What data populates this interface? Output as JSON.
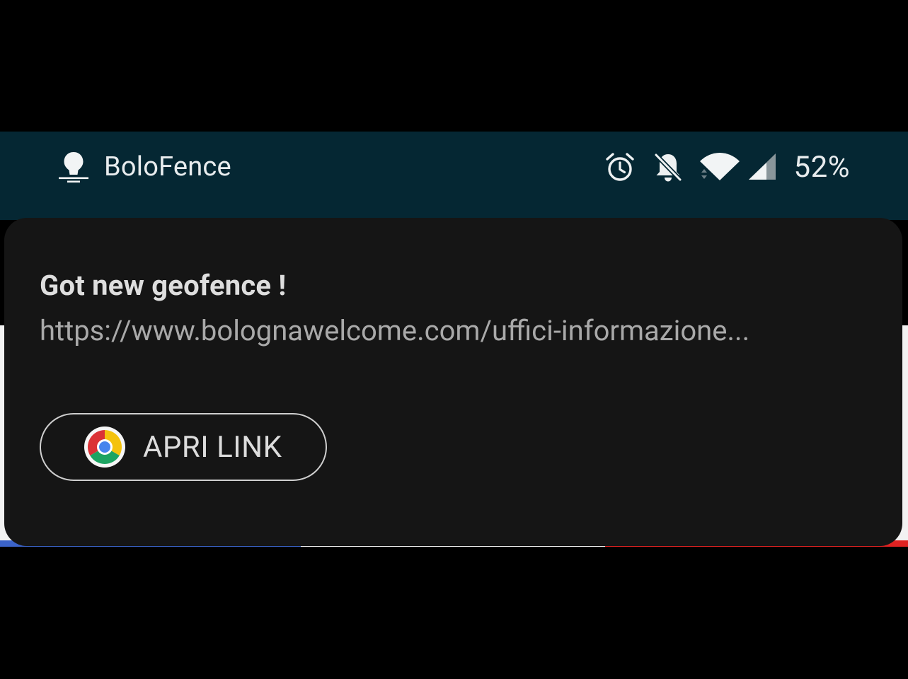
{
  "status_bar": {
    "app_icon": "lightbulb-location-icon",
    "app_name": "BoloFence",
    "icons": [
      "alarm-icon",
      "notifications-off-icon",
      "wifi-icon",
      "cell-signal-icon"
    ],
    "battery": "52%",
    "background_color": "#052733"
  },
  "notification": {
    "title": "Got new geofence !",
    "body": "https://www.bolognawelcome.com/uffici-informazione...",
    "action": {
      "icon": "chrome-icon",
      "label": "APRI LINK"
    },
    "background_color": "#151515"
  }
}
